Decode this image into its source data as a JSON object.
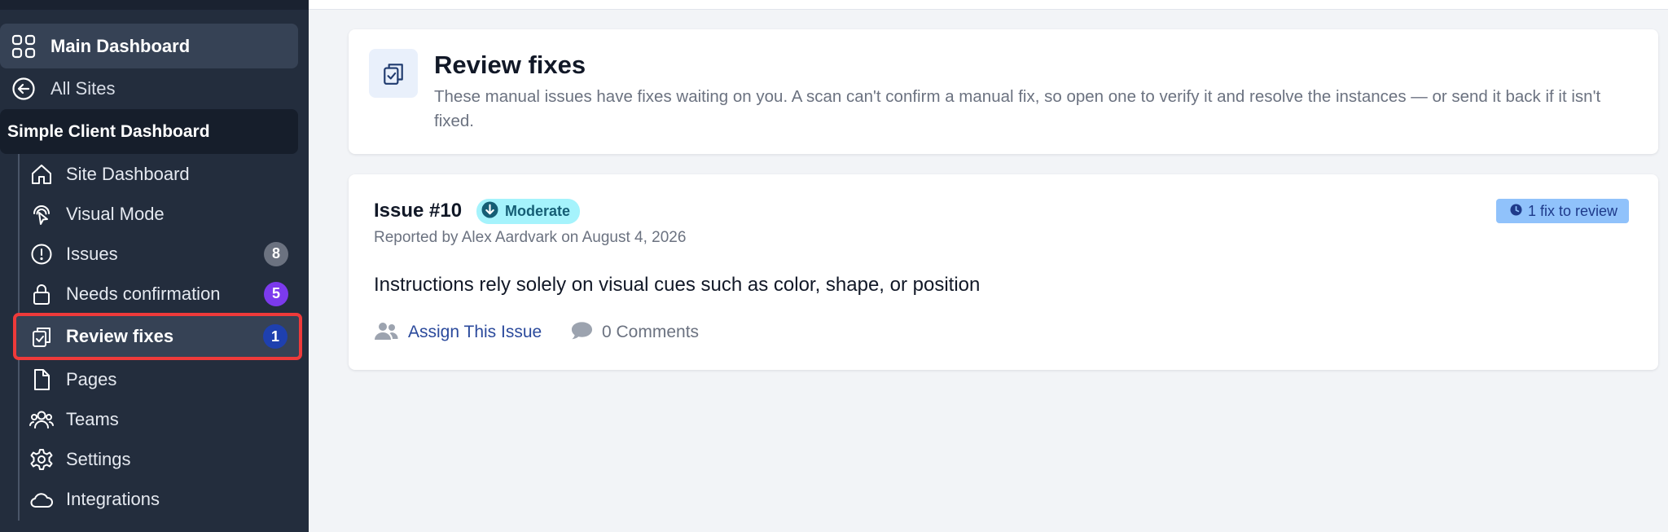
{
  "colors": {
    "sidebar_bg": "#232d3d",
    "active_outline": "#ef3a3a",
    "badge_gray": "#6b7280",
    "badge_purple": "#7c3aed",
    "badge_blue": "#1e40af",
    "severity_bg": "#a5f3fc",
    "review_badge_bg": "#90c2fb",
    "link_blue": "#2b4a9c"
  },
  "sidebar": {
    "main_dashboard": {
      "label": "Main Dashboard",
      "icon": "grid-icon"
    },
    "all_sites": {
      "label": "All Sites",
      "icon": "back-arrow-circle-icon"
    },
    "client_header": "Simple Client Dashboard",
    "items": [
      {
        "label": "Site Dashboard",
        "icon": "home-icon"
      },
      {
        "label": "Visual Mode",
        "icon": "touch-pointer-icon"
      },
      {
        "label": "Issues",
        "icon": "alert-circle-icon",
        "badge": "8"
      },
      {
        "label": "Needs confirmation",
        "icon": "lock-icon",
        "badge": "5"
      },
      {
        "label": "Review fixes",
        "icon": "clipboard-check-icon",
        "badge": "1",
        "active": true
      },
      {
        "label": "Pages",
        "icon": "document-icon"
      },
      {
        "label": "Teams",
        "icon": "users-icon"
      },
      {
        "label": "Settings",
        "icon": "gear-icon"
      },
      {
        "label": "Integrations",
        "icon": "cloud-icon"
      }
    ]
  },
  "header": {
    "title": "Review fixes",
    "description": "These manual issues have fixes waiting on you. A scan can't confirm a manual fix, so open one to verify it and resolve the instances — or send it back if it isn't fixed."
  },
  "issue": {
    "title": "Issue #10",
    "severity": "Moderate",
    "reported": "Reported by Alex Aardvark on August 4, 2026",
    "review_badge": "1 fix to review",
    "description": "Instructions rely solely on visual cues such as color, shape, or position",
    "assign_label": "Assign This Issue",
    "comments_label": "0 Comments"
  }
}
